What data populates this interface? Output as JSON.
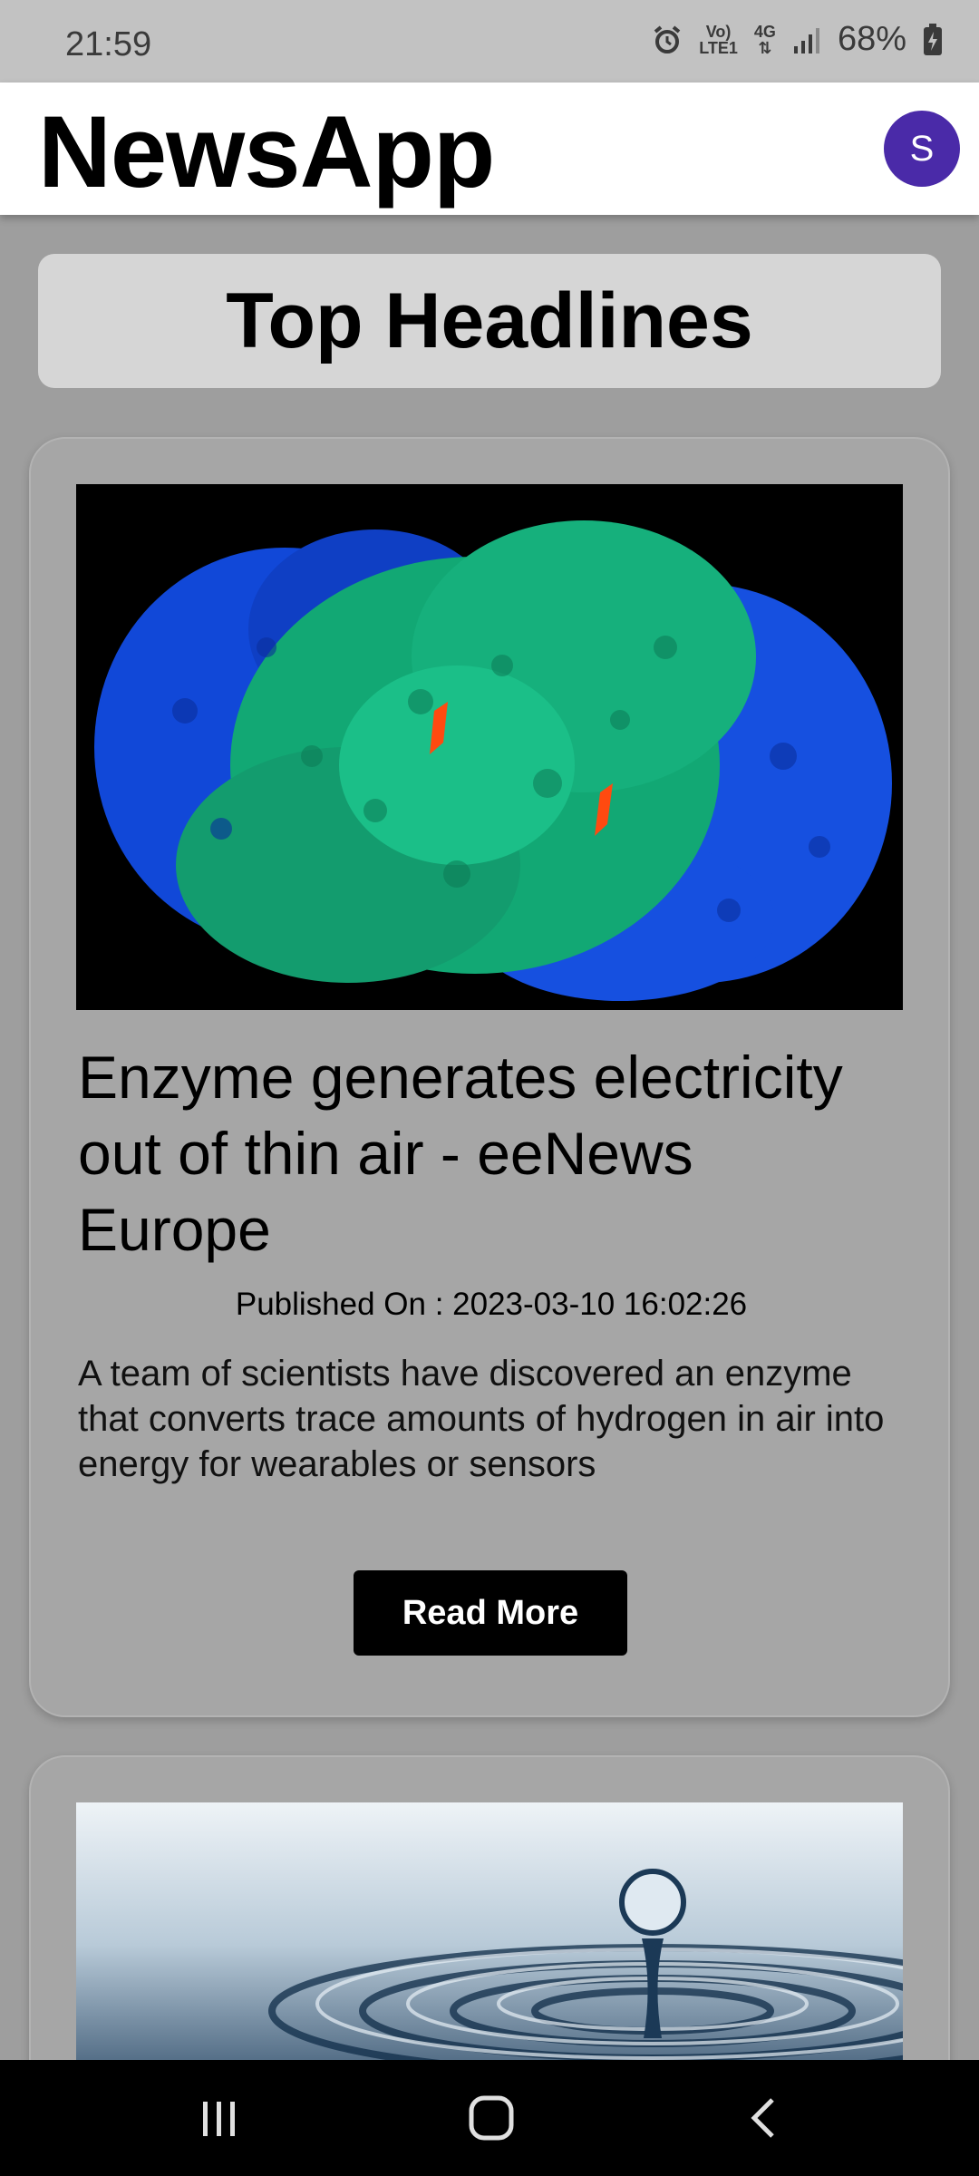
{
  "status_bar": {
    "time": "21:59",
    "network_top": "Vo)",
    "network_bottom": "LTE1",
    "signal_type": "4G",
    "battery": "68%"
  },
  "app_bar": {
    "title": "NewsApp",
    "avatar_letter": "S"
  },
  "section": {
    "title": "Top Headlines"
  },
  "articles": [
    {
      "title": "Enzyme generates electricity out of thin air - eeNews Europe",
      "published": "Published On : 2023-03-10 16:02:26",
      "description": "A team of scientists have discovered an enzyme that converts trace amounts of hydrogen in air into energy for wearables or sensors",
      "button_label": "Read More",
      "image": "protein-enzyme-structure"
    },
    {
      "image": "water-droplet-ripple"
    }
  ],
  "colors": {
    "background": "#9e9e9e",
    "card": "#a6a6a6",
    "header_box": "#d6d6d6",
    "avatar": "#4a2aa8",
    "button": "#000000"
  }
}
